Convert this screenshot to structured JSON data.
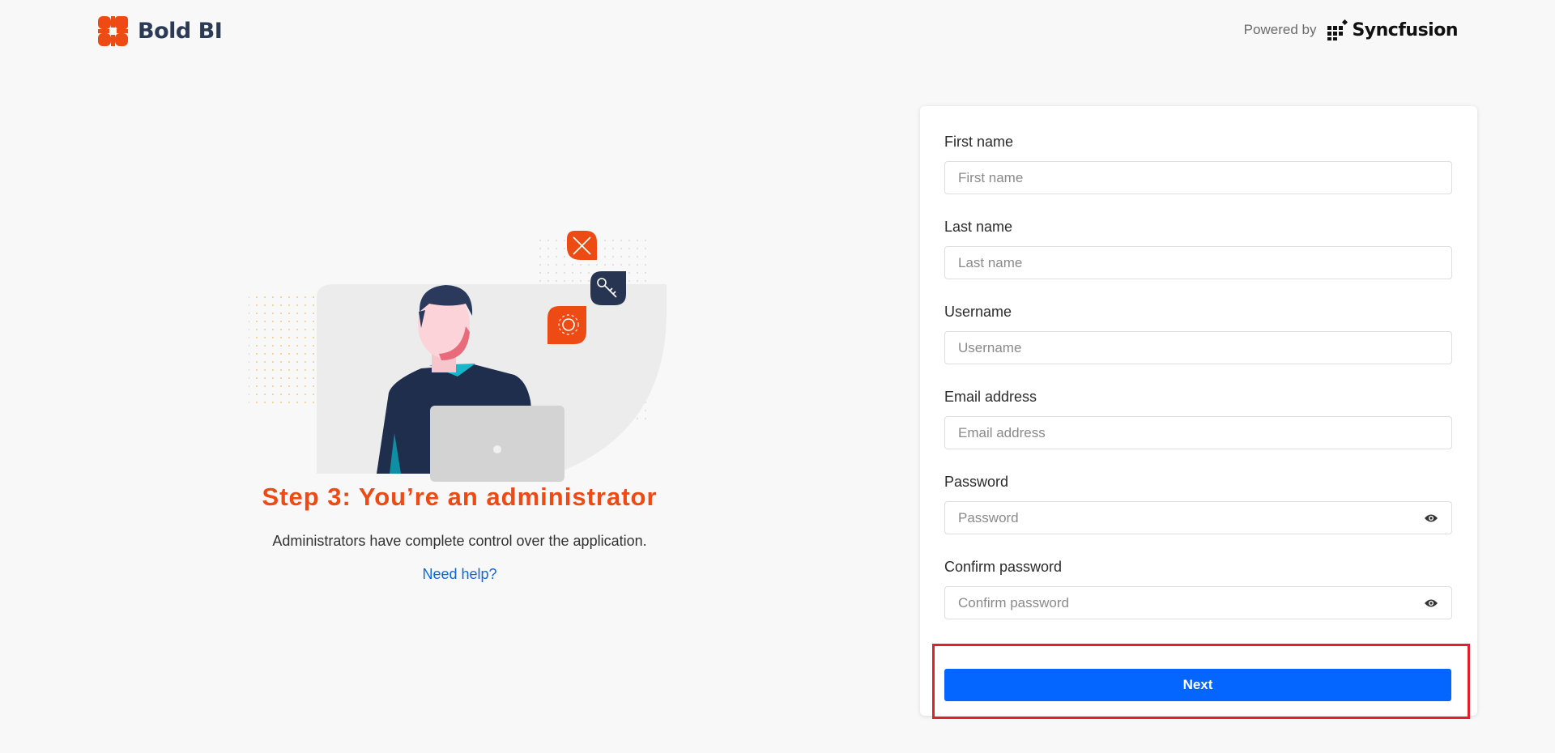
{
  "header": {
    "logo_text": "Bold BI",
    "powered_by": "Powered by",
    "partner_logo": "Syncfusion"
  },
  "left": {
    "step_title": "Step 3: You’re an administrator",
    "description": "Administrators have complete control over the application.",
    "help_link": "Need help?"
  },
  "form": {
    "first_name": {
      "label": "First name",
      "placeholder": "First name",
      "value": ""
    },
    "last_name": {
      "label": "Last name",
      "placeholder": "Last name",
      "value": ""
    },
    "username": {
      "label": "Username",
      "placeholder": "Username",
      "value": ""
    },
    "email": {
      "label": "Email address",
      "placeholder": "Email address",
      "value": ""
    },
    "password": {
      "label": "Password",
      "placeholder": "Password",
      "value": ""
    },
    "confirm_password": {
      "label": "Confirm password",
      "placeholder": "Confirm password",
      "value": ""
    },
    "next_label": "Next"
  },
  "colors": {
    "brand_orange": "#ee4a14",
    "brand_navy": "#2b3a55",
    "primary_button": "#0565ff",
    "link": "#0b6ae0",
    "highlight_border": "#e0202a"
  },
  "icons": {
    "logo": "bold-bi-logo-icon",
    "show_password": "eye-icon",
    "tools": "tools-icon",
    "key": "key-icon",
    "settings": "gear-icon"
  }
}
